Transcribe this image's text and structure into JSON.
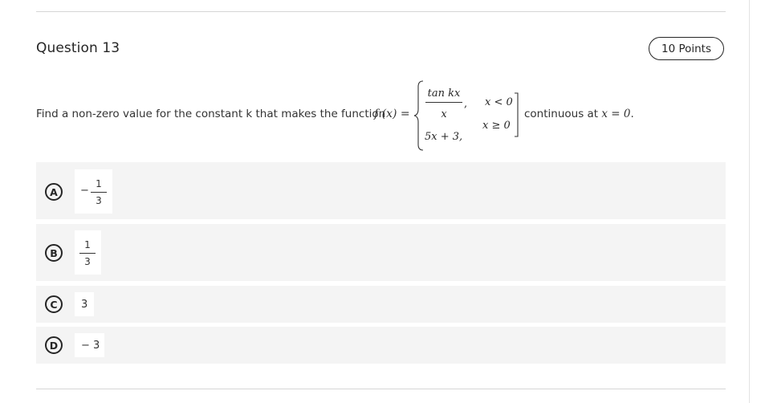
{
  "question": {
    "title": "Question 13",
    "points": "10 Points",
    "prompt": {
      "before": "Find a non-zero value for the constant k that makes the function",
      "function_name": "f (x) =",
      "case1_numerator": "tan kx",
      "case1_denominator": "x",
      "case1_comma": ",",
      "case1_condition": "x < 0",
      "case2_expression": "5x + 3,",
      "case2_condition": "x ≥ 0",
      "after_prefix": "continuous at",
      "after_math": "x = 0",
      "after_period": "."
    }
  },
  "options": [
    {
      "letter": "A",
      "sign": "−",
      "numerator": "1",
      "denominator": "3",
      "text": ""
    },
    {
      "letter": "B",
      "sign": "",
      "numerator": "1",
      "denominator": "3",
      "text": ""
    },
    {
      "letter": "C",
      "sign": "",
      "numerator": "",
      "denominator": "",
      "text": "3"
    },
    {
      "letter": "D",
      "sign": "",
      "numerator": "",
      "denominator": "",
      "text": "− 3"
    }
  ],
  "colors": {
    "option_bg": "#f4f4f4",
    "border": "#262626",
    "rule": "#d6d6d6"
  }
}
